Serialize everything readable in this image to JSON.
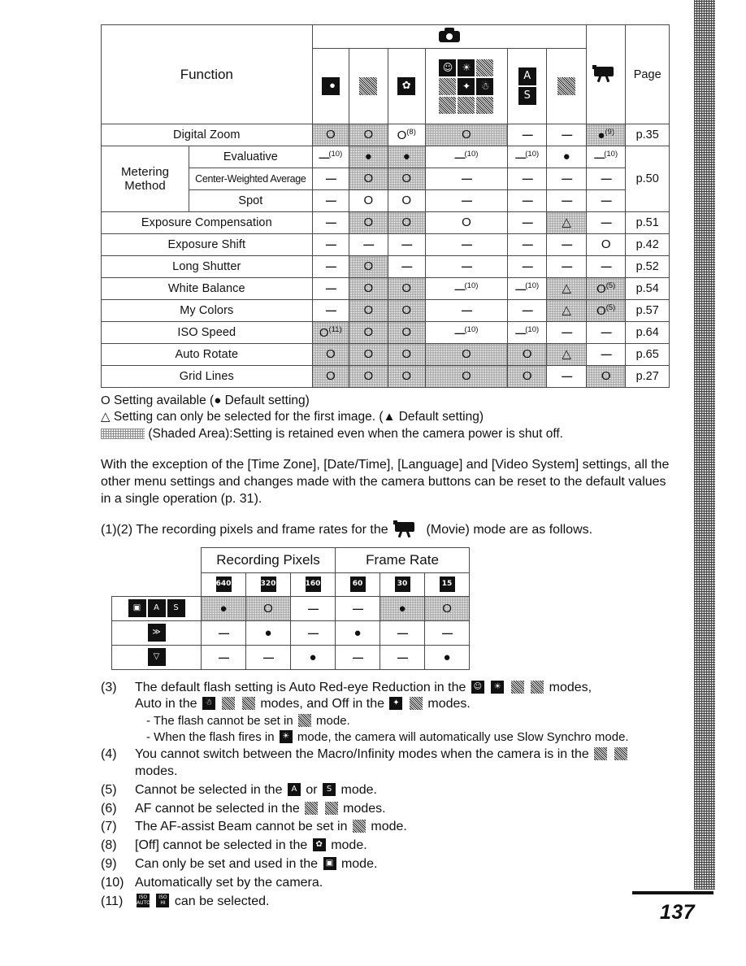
{
  "page_number": "137",
  "main_table": {
    "col_function": "Function",
    "col_page": "Page",
    "shooting_group_icon": "camera-icon",
    "mode_columns": [
      {
        "icon": "auto-mode-icon",
        "name": "auto"
      },
      {
        "icon": "manual-mode-icon",
        "name": "manual"
      },
      {
        "icon": "digital-macro-mode-icon",
        "name": "digital-macro"
      },
      {
        "icon": "scene-modes-grid-icon",
        "name": "scene-modes"
      },
      {
        "icon": "color-accent-swap-icon",
        "name": "color-accent-swap"
      },
      {
        "icon": "stitch-assist-icon",
        "name": "stitch-assist"
      },
      {
        "icon": "movie-mode-icon",
        "name": "movie"
      }
    ],
    "scene_icons": [
      "portrait",
      "night-snapshot",
      "kids-and-pets",
      "indoor",
      "foliage",
      "snow",
      "beach",
      "fireworks",
      "underwater"
    ],
    "rows": [
      {
        "label": "Digital Zoom",
        "page": "p.35",
        "cells": [
          {
            "mark": "O",
            "shaded": true
          },
          {
            "mark": "O",
            "shaded": true
          },
          {
            "mark": "O",
            "sup": "(8)",
            "shaded": false
          },
          {
            "mark": "O",
            "shaded": true
          },
          {
            "mark": "-",
            "shaded": false
          },
          {
            "mark": "-",
            "shaded": false
          },
          {
            "mark": "●",
            "sup": "(9)",
            "shaded": true
          }
        ]
      },
      {
        "label": "Metering Method",
        "group": true,
        "page": "p.50",
        "sub_rows": [
          {
            "label": "Evaluative",
            "cells": [
              {
                "mark": "-",
                "sup": "(10)",
                "shaded": false
              },
              {
                "mark": "●",
                "shaded": true
              },
              {
                "mark": "●",
                "shaded": true
              },
              {
                "mark": "-",
                "sup": "(10)",
                "shaded": false
              },
              {
                "mark": "-",
                "sup": "(10)",
                "shaded": false
              },
              {
                "mark": "●",
                "shaded": false
              },
              {
                "mark": "-",
                "sup": "(10)",
                "shaded": false
              }
            ]
          },
          {
            "label": "Center-Weighted Average",
            "small": true,
            "cells": [
              {
                "mark": "-",
                "shaded": false
              },
              {
                "mark": "O",
                "shaded": true
              },
              {
                "mark": "O",
                "shaded": true
              },
              {
                "mark": "-",
                "shaded": false
              },
              {
                "mark": "-",
                "shaded": false
              },
              {
                "mark": "-",
                "shaded": false
              },
              {
                "mark": "-",
                "shaded": false
              }
            ]
          },
          {
            "label": "Spot",
            "cells": [
              {
                "mark": "-",
                "shaded": false
              },
              {
                "mark": "O",
                "shaded": false
              },
              {
                "mark": "O",
                "shaded": false
              },
              {
                "mark": "-",
                "shaded": false
              },
              {
                "mark": "-",
                "shaded": false
              },
              {
                "mark": "-",
                "shaded": false
              },
              {
                "mark": "-",
                "shaded": false
              }
            ]
          }
        ]
      },
      {
        "label": "Exposure Compensation",
        "page": "p.51",
        "cells": [
          {
            "mark": "-",
            "shaded": false
          },
          {
            "mark": "O",
            "shaded": true
          },
          {
            "mark": "O",
            "shaded": true
          },
          {
            "mark": "O",
            "shaded": false
          },
          {
            "mark": "-",
            "shaded": false
          },
          {
            "mark": "△",
            "shaded": true
          },
          {
            "mark": "-",
            "shaded": false
          }
        ]
      },
      {
        "label": "Exposure Shift",
        "page": "p.42",
        "cells": [
          {
            "mark": "-",
            "shaded": false
          },
          {
            "mark": "-",
            "shaded": false
          },
          {
            "mark": "-",
            "shaded": false
          },
          {
            "mark": "-",
            "shaded": false
          },
          {
            "mark": "-",
            "shaded": false
          },
          {
            "mark": "-",
            "shaded": false
          },
          {
            "mark": "O",
            "shaded": false
          }
        ]
      },
      {
        "label": "Long Shutter",
        "page": "p.52",
        "cells": [
          {
            "mark": "-",
            "shaded": false
          },
          {
            "mark": "O",
            "shaded": true
          },
          {
            "mark": "-",
            "shaded": false
          },
          {
            "mark": "-",
            "shaded": false
          },
          {
            "mark": "-",
            "shaded": false
          },
          {
            "mark": "-",
            "shaded": false
          },
          {
            "mark": "-",
            "shaded": false
          }
        ]
      },
      {
        "label": "White Balance",
        "page": "p.54",
        "cells": [
          {
            "mark": "-",
            "shaded": false
          },
          {
            "mark": "O",
            "shaded": true
          },
          {
            "mark": "O",
            "shaded": true
          },
          {
            "mark": "-",
            "sup": "(10)",
            "shaded": false
          },
          {
            "mark": "-",
            "sup": "(10)",
            "shaded": false
          },
          {
            "mark": "△",
            "shaded": true
          },
          {
            "mark": "O",
            "sup": "(5)",
            "shaded": true
          }
        ]
      },
      {
        "label": "My Colors",
        "page": "p.57",
        "cells": [
          {
            "mark": "-",
            "shaded": false
          },
          {
            "mark": "O",
            "shaded": true
          },
          {
            "mark": "O",
            "shaded": true
          },
          {
            "mark": "-",
            "shaded": false
          },
          {
            "mark": "-",
            "shaded": false
          },
          {
            "mark": "△",
            "shaded": true
          },
          {
            "mark": "O",
            "sup": "(5)",
            "shaded": true
          }
        ]
      },
      {
        "label": "ISO Speed",
        "page": "p.64",
        "cells": [
          {
            "mark": "O",
            "sup": "(11)",
            "shaded": true
          },
          {
            "mark": "O",
            "shaded": true
          },
          {
            "mark": "O",
            "shaded": true
          },
          {
            "mark": "-",
            "sup": "(10)",
            "shaded": false
          },
          {
            "mark": "-",
            "sup": "(10)",
            "shaded": false
          },
          {
            "mark": "-",
            "shaded": false
          },
          {
            "mark": "-",
            "shaded": false
          }
        ]
      },
      {
        "label": "Auto Rotate",
        "page": "p.65",
        "cells": [
          {
            "mark": "O",
            "shaded": true
          },
          {
            "mark": "O",
            "shaded": true
          },
          {
            "mark": "O",
            "shaded": true
          },
          {
            "mark": "O",
            "shaded": true
          },
          {
            "mark": "O",
            "shaded": true
          },
          {
            "mark": "△",
            "shaded": true
          },
          {
            "mark": "-",
            "shaded": false
          }
        ]
      },
      {
        "label": "Grid Lines",
        "page": "p.27",
        "cells": [
          {
            "mark": "O",
            "shaded": true
          },
          {
            "mark": "O",
            "shaded": true
          },
          {
            "mark": "O",
            "shaded": true
          },
          {
            "mark": "O",
            "shaded": true
          },
          {
            "mark": "O",
            "shaded": true
          },
          {
            "mark": "-",
            "shaded": false
          },
          {
            "mark": "O",
            "shaded": true
          }
        ]
      }
    ]
  },
  "legend": {
    "line1_mark": "O",
    "line1_text": "Setting available (",
    "line1_mark2": "●",
    "line1_text2": " Default setting)",
    "line2_mark": "△",
    "line2_text": "Setting can only be selected for the first image. (",
    "line2_mark2": "▲",
    "line2_text2": " Default setting)",
    "line3_text": "(Shaded Area):Setting is retained even when the camera power is shut off."
  },
  "paragraph1": "With the exception of the [Time Zone], [Date/Time], [Language] and [Video System] settings, all the other menu settings and changes made with the camera buttons can be reset to the default values in a single operation (p. 31).",
  "paragraph2_pre": "(1)(2) The recording pixels and frame rates for the",
  "paragraph2_post": "(Movie) mode are as follows.",
  "movie_table": {
    "header_groups": [
      "Recording Pixels",
      "Frame Rate"
    ],
    "col_icons": [
      "640",
      "320",
      "160",
      "60",
      "30",
      "15"
    ],
    "rows": [
      {
        "row_icons": [
          "movie-standard-icon",
          "color-accent-icon",
          "color-swap-icon"
        ],
        "cells": [
          {
            "mark": "●",
            "shaded": true
          },
          {
            "mark": "O",
            "shaded": true
          },
          {
            "mark": "-",
            "shaded": false
          },
          {
            "mark": "-",
            "shaded": false
          },
          {
            "mark": "●",
            "shaded": true
          },
          {
            "mark": "O",
            "shaded": true
          }
        ]
      },
      {
        "row_icons": [
          "fast-frame-rate-icon"
        ],
        "cells": [
          {
            "mark": "-",
            "shaded": false
          },
          {
            "mark": "●",
            "shaded": false
          },
          {
            "mark": "-",
            "shaded": false
          },
          {
            "mark": "●",
            "shaded": false
          },
          {
            "mark": "-",
            "shaded": false
          },
          {
            "mark": "-",
            "shaded": false
          }
        ]
      },
      {
        "row_icons": [
          "compact-movie-icon"
        ],
        "cells": [
          {
            "mark": "-",
            "shaded": false
          },
          {
            "mark": "-",
            "shaded": false
          },
          {
            "mark": "●",
            "shaded": false
          },
          {
            "mark": "-",
            "shaded": false
          },
          {
            "mark": "-",
            "shaded": false
          },
          {
            "mark": "●",
            "shaded": false
          }
        ]
      }
    ]
  },
  "notes": [
    {
      "num": "(3)",
      "seg1": "The default flash setting is Auto Red-eye Reduction in the",
      "seg2": "modes,",
      "seg3": "Auto in the",
      "seg4": "modes, and Off in the",
      "seg5": "modes.",
      "sub1_pre": "- The flash cannot be set in",
      "sub1_post": "mode.",
      "sub2_pre": "- When the flash fires in",
      "sub2_post": "mode, the camera will automatically use Slow Synchro mode."
    },
    {
      "num": "(4)",
      "seg1": "You cannot switch between the Macro/Infinity modes when the camera is in the",
      "seg2": "modes."
    },
    {
      "num": "(5)",
      "seg1": "Cannot be selected in the",
      "seg2": "or",
      "seg3": "mode."
    },
    {
      "num": "(6)",
      "seg1": "AF cannot be selected in the",
      "seg2": "modes."
    },
    {
      "num": "(7)",
      "seg1": "The AF-assist Beam cannot be set in",
      "seg2": "mode."
    },
    {
      "num": "(8)",
      "seg1": "[Off] cannot be selected in the",
      "seg2": "mode."
    },
    {
      "num": "(9)",
      "seg1": "Can only be set and used in the",
      "seg2": "mode."
    },
    {
      "num": "(10)",
      "seg1": "Automatically set by the camera."
    },
    {
      "num": "(11)",
      "seg1": "can be selected."
    }
  ]
}
